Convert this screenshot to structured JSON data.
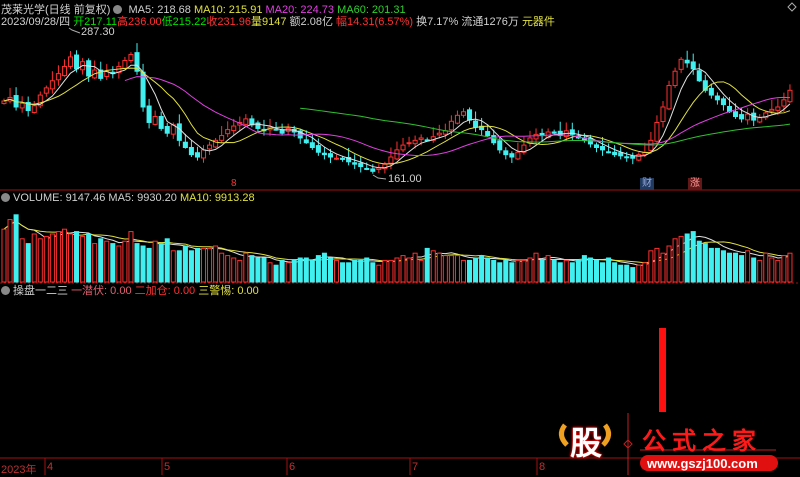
{
  "header": {
    "title": "茂莱光学(日线 前复权)",
    "ma5": "MA5: 218.68",
    "ma10": "MA10: 215.91",
    "ma20": "MA20: 224.73",
    "ma60": "MA60: 201.31",
    "date": "2023/09/28/四",
    "open": "开217.11",
    "high": "高236.00",
    "low": "低215.22",
    "close": "收231.96",
    "volume": "量9147",
    "amount": "额2.08亿",
    "change": "幅14.31(6.57%)",
    "turnover": "换7.17%",
    "float": "流通1276万",
    "sector": "元器件"
  },
  "volume_header": {
    "volume": "VOLUME: 9147.46",
    "ma5": "MA5: 9930.20",
    "ma10": "MA10: 9913.28"
  },
  "indicator_header": {
    "name": "操盘一二三",
    "l1": "一潜伏: 0.00",
    "l2": "二加仓: 0.00",
    "l3": "三警惕: 0.00"
  },
  "annotations": {
    "max_label": "287.30",
    "min_label": "161.00",
    "marker_8": "8",
    "marker_cai": "财",
    "marker_zhang": "涨"
  },
  "x_axis": {
    "year": "2023年",
    "months": [
      "4",
      "5",
      "6",
      "7",
      "8"
    ]
  },
  "logo": {
    "char": "股",
    "name": "公式之家",
    "url": "www.gszj100.com"
  },
  "colors": {
    "up": "#ff3030",
    "down": "#40f0f0",
    "ma5": "#e0e0e0",
    "ma10": "#e0e040",
    "ma20": "#e040e0",
    "ma60": "#30c030"
  },
  "chart_data": {
    "type": "candlestick",
    "title": "茂莱光学(日线 前复权)",
    "price_range": [
      150,
      291
    ],
    "close": [
      223,
      226,
      218,
      221,
      215,
      219,
      228,
      234,
      240,
      246,
      252,
      260,
      250,
      256,
      244,
      249,
      242,
      248,
      246,
      252,
      257,
      262,
      248,
      218,
      205,
      210,
      200,
      196,
      203,
      190,
      184,
      178,
      176,
      182,
      186,
      190,
      194,
      199,
      202,
      205,
      208,
      203,
      200,
      198,
      201,
      199,
      196,
      200,
      197,
      192,
      188,
      184,
      180,
      178,
      176,
      175,
      174,
      172,
      170,
      168,
      166,
      164,
      167,
      170,
      176,
      182,
      186,
      188,
      190,
      192,
      190,
      193,
      196,
      198,
      206,
      211,
      214,
      207,
      201,
      199,
      194,
      188,
      182,
      178,
      176,
      180,
      186,
      192,
      195,
      194,
      197,
      196,
      194,
      198,
      195,
      192,
      190,
      187,
      184,
      182,
      180,
      178,
      177,
      176,
      175,
      178,
      180,
      190,
      205,
      218,
      236,
      248,
      258,
      255,
      250,
      240,
      232,
      228,
      224,
      220,
      214,
      210,
      208,
      212,
      207,
      209,
      213,
      216,
      218,
      224,
      232
    ],
    "volume_thousands": [
      22,
      26,
      28,
      18,
      16,
      20,
      18,
      19,
      20,
      21,
      22,
      20,
      21,
      19,
      20,
      16,
      18,
      17,
      16,
      15,
      17,
      21,
      16,
      15,
      14,
      17,
      16,
      18,
      13,
      13,
      15,
      13,
      14,
      14,
      14,
      15,
      12,
      11,
      10,
      9,
      12,
      11,
      10,
      10,
      8,
      7,
      9,
      8,
      9,
      10,
      10,
      9,
      11,
      12,
      10,
      9,
      8,
      8,
      9,
      9,
      10,
      8,
      7,
      9,
      9,
      10,
      11,
      10,
      12,
      9,
      14,
      13,
      12,
      11,
      11,
      11,
      9,
      9,
      10,
      11,
      10,
      9,
      8,
      9,
      8,
      9,
      9,
      10,
      12,
      9,
      11,
      9,
      8,
      9,
      8,
      9,
      11,
      10,
      9,
      8,
      10,
      8,
      7,
      7,
      6,
      7,
      8,
      13,
      14,
      12,
      15,
      18,
      19,
      20,
      21,
      17,
      16,
      14,
      14,
      13,
      12,
      12,
      11,
      13,
      10,
      9,
      12,
      10,
      9,
      11,
      12
    ],
    "indicator": {
      "bar_index": 109,
      "value": 1
    }
  }
}
